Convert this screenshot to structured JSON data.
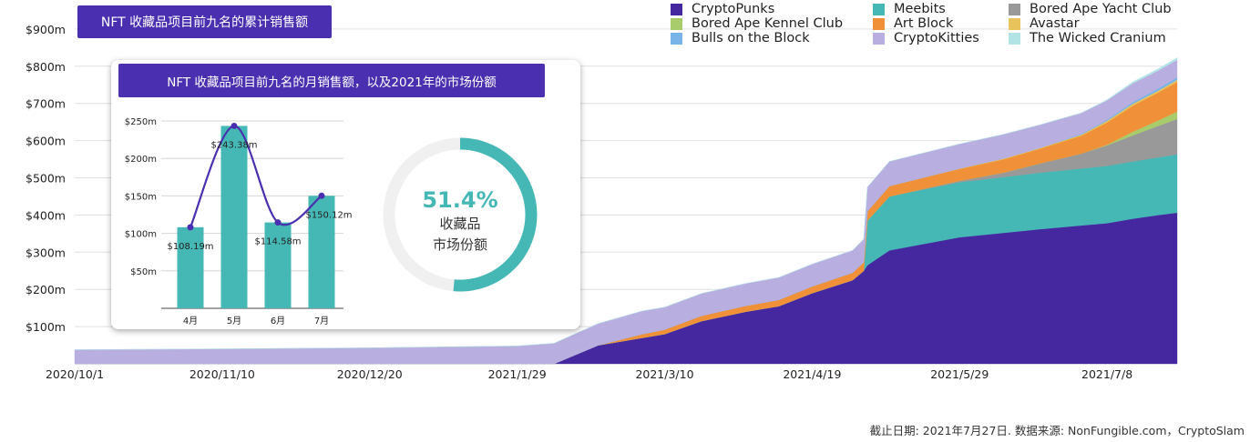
{
  "chart_data": [
    {
      "type": "area",
      "title": "NFT 收藏品项目前九名的累计销售额",
      "stacked": true,
      "x": [
        "2020/10/1",
        "2020/11/10",
        "2020/12/20",
        "2021/1/29",
        "2021/2/8",
        "2021/2/20",
        "2021/3/4",
        "2021/3/10",
        "2021/3/20",
        "2021/4/1",
        "2021/4/10",
        "2021/4/19",
        "2021/4/30",
        "2021/5/3",
        "2021/5/4",
        "2021/5/10",
        "2021/5/29",
        "2021/6/10",
        "2021/6/20",
        "2021/7/1",
        "2021/7/8",
        "2021/7/15",
        "2021/7/22",
        "2021/7/27"
      ],
      "x_ticks": [
        "2020/10/1",
        "2020/11/10",
        "2020/12/20",
        "2021/1/29",
        "2021/3/10",
        "2021/4/19",
        "2021/5/29",
        "2021/7/8"
      ],
      "y_ticks": [
        "$100m",
        "$200m",
        "$300m",
        "$400m",
        "$500m",
        "$600m",
        "$700m",
        "$800m",
        "$900m"
      ],
      "ylim": [
        0,
        900
      ],
      "unit": "m",
      "series": [
        {
          "name": "CryptoPunks",
          "color": "#4527a0",
          "values": [
            0,
            0,
            0,
            0,
            0,
            50,
            70,
            80,
            115,
            140,
            155,
            190,
            225,
            250,
            265,
            305,
            340,
            352,
            362,
            372,
            378,
            390,
            400,
            406
          ]
        },
        {
          "name": "Meebits",
          "color": "#45b8b5",
          "values": [
            0,
            0,
            0,
            0,
            0,
            0,
            0,
            0,
            0,
            0,
            0,
            0,
            0,
            0,
            120,
            145,
            148,
            150,
            152,
            153,
            154,
            154,
            155,
            157
          ]
        },
        {
          "name": "Bored Ape Yacht Club",
          "color": "#999999",
          "values": [
            0,
            0,
            0,
            0,
            0,
            0,
            0,
            0,
            0,
            0,
            0,
            0,
            0,
            0,
            0,
            0,
            4,
            12,
            25,
            40,
            55,
            70,
            85,
            95
          ]
        },
        {
          "name": "Bored Ape Kennel Club",
          "color": "#a8cc6c",
          "values": [
            0,
            0,
            0,
            0,
            0,
            0,
            0,
            0,
            0,
            0,
            0,
            0,
            0,
            0,
            0,
            0,
            0,
            0,
            0,
            0,
            2,
            10,
            15,
            20
          ]
        },
        {
          "name": "Art Block",
          "color": "#f0913a",
          "values": [
            0,
            0,
            0,
            0,
            0,
            0,
            10,
            12,
            14,
            16,
            17,
            18,
            20,
            23,
            25,
            28,
            32,
            36,
            40,
            48,
            60,
            70,
            75,
            80
          ]
        },
        {
          "name": "Avastar",
          "color": "#e8c25a",
          "values": [
            0,
            0,
            0,
            0,
            0,
            0,
            0,
            0,
            0,
            0,
            0,
            0,
            0,
            0,
            0,
            0,
            1,
            2,
            2,
            3,
            4,
            5,
            5,
            5
          ]
        },
        {
          "name": "Bulls on the Block",
          "color": "#78b4e8",
          "values": [
            0,
            0,
            0,
            0,
            0,
            0,
            0,
            0,
            0,
            0,
            0,
            0,
            0,
            0,
            0,
            0,
            0,
            0,
            0,
            2,
            3,
            5,
            6,
            7
          ]
        },
        {
          "name": "CryptoKitties",
          "color": "#b9aee0",
          "values": [
            38,
            40,
            43,
            48,
            55,
            58,
            62,
            60,
            60,
            60,
            60,
            60,
            60,
            62,
            65,
            66,
            66,
            65,
            62,
            56,
            52,
            50,
            48,
            47
          ]
        },
        {
          "name": "The Wicked Cranium",
          "color": "#b2e4e6",
          "values": [
            0,
            0,
            0,
            0,
            0,
            0,
            0,
            0,
            0,
            0,
            0,
            0,
            0,
            0,
            0,
            0,
            0,
            0,
            0,
            0,
            2,
            4,
            5,
            6
          ]
        }
      ]
    },
    {
      "type": "bar",
      "title": "NFT 收藏品项目前九名的月销售额，以及2021年的市场份额",
      "categories": [
        "4月",
        "5月",
        "6月",
        "7月"
      ],
      "values": [
        108.19,
        243.38,
        114.58,
        150.12
      ],
      "data_labels": [
        "$108.19m",
        "$243.38m",
        "$114.58m",
        "$150.12m"
      ],
      "y_ticks": [
        "$50m",
        "$100m",
        "$150m",
        "$200m",
        "$250m"
      ],
      "ylim": [
        0,
        250
      ],
      "bar_color": "#45b8b5",
      "line_color": "#4a2fb0"
    },
    {
      "type": "pie",
      "value": 51.4,
      "value_label": "51.4%",
      "label_line1": "收藏品",
      "label_line2": "市场份额",
      "color": "#45b8b5",
      "track_color": "#f0f0f0"
    }
  ],
  "source_note": "截止日期: 2021年7月27日. 数据来源: NonFungible.com，CryptoSlam"
}
